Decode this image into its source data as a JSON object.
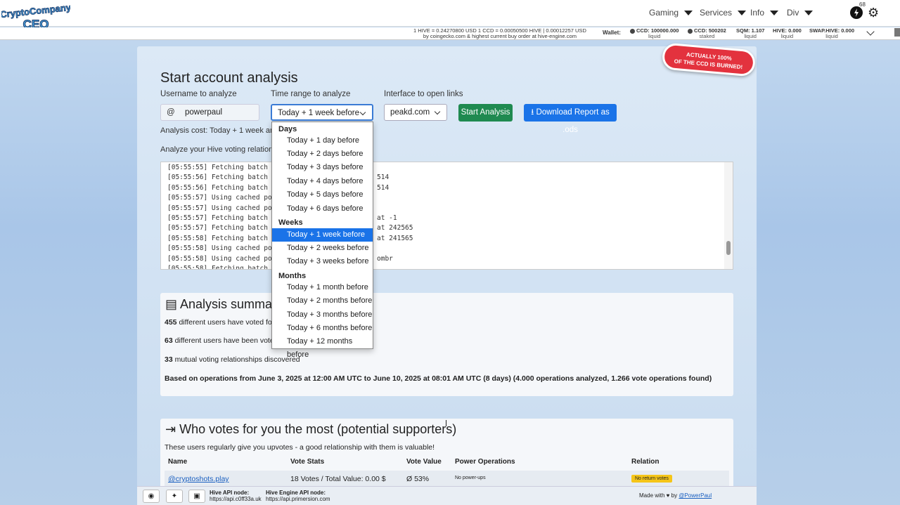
{
  "header": {
    "logo_text_top": "CryptoCompany",
    "logo_text_bottom": "CEO",
    "nav": [
      "Gaming",
      "Services",
      "Info",
      "Div"
    ],
    "notification_count": "68"
  },
  "infobar": {
    "rate_line1": "1 HIVE = 0.24270800 USD      1 CCD = 0.00050500 HIVE | 0.00012257 USD",
    "rate_line2": "by coingecko.com & highest current buy order at hive-engine.com",
    "wallet_label": "Wallet:",
    "wallet": [
      {
        "value": "CCD: 100000.000",
        "sub": "liquid"
      },
      {
        "value": "CCD: 500202",
        "sub": "staked"
      },
      {
        "value": "SQM: 1.107",
        "sub": "liquid"
      },
      {
        "value": "HIVE: 0.000",
        "sub": "liquid"
      },
      {
        "value": "SWAP.HIVE: 0.000",
        "sub": "liquid"
      }
    ]
  },
  "burn_badge": {
    "line1": "ACTUALLY 100%",
    "line2": "OF THE CCD IS BURNED!"
  },
  "form": {
    "title": "Start account analysis",
    "username_label": "Username to analyze",
    "at_sign": "@",
    "username_value": "powerpaul",
    "time_label": "Time range to analyze",
    "time_value": "Today + 1 week before",
    "interface_label": "Interface to open links",
    "interface_value": "peakd.com",
    "start_button": "Start Analysis",
    "download_button": "Download Report as .ods",
    "cost_text": "Analysis cost: Today + 1 week analysis c",
    "analyze_text": "Analyze your Hive voting relationships..."
  },
  "log": [
    {
      "time": "[05:55:55]",
      "msg": "Fetching batch fo",
      "tail": ""
    },
    {
      "time": "[05:55:56]",
      "msg": "Fetching batch fo",
      "tail": "514"
    },
    {
      "time": "[05:55:56]",
      "msg": "Fetching batch fo",
      "tail": "514"
    },
    {
      "time": "[05:55:57]",
      "msg": "Using cached powe",
      "tail": ""
    },
    {
      "time": "[05:55:57]",
      "msg": "Using cached powe",
      "tail": ""
    },
    {
      "time": "[05:55:57]",
      "msg": "Fetching batch fo",
      "tail": "at -1"
    },
    {
      "time": "[05:55:57]",
      "msg": "Fetching batch fo",
      "tail": "at 242565"
    },
    {
      "time": "[05:55:58]",
      "msg": "Fetching batch fo",
      "tail": "at 241565"
    },
    {
      "time": "[05:55:58]",
      "msg": "Using cached powe",
      "tail": ""
    },
    {
      "time": "[05:55:58]",
      "msg": "Using cached powe",
      "tail": "ombr"
    },
    {
      "time": "[05:55:58]",
      "msg": "Fetching batch fo",
      "tail": ""
    }
  ],
  "dropdown": {
    "groups": [
      {
        "label": "Days",
        "options": [
          "Today + 1 day before",
          "Today + 2 days before",
          "Today + 3 days before",
          "Today + 4 days before",
          "Today + 5 days before",
          "Today + 6 days before"
        ]
      },
      {
        "label": "Weeks",
        "options": [
          "Today + 1 week before",
          "Today + 2 weeks before",
          "Today + 3 weeks before"
        ]
      },
      {
        "label": "Months",
        "options": [
          "Today + 1 month before",
          "Today + 2 months before",
          "Today + 3 months before",
          "Today + 6 months before",
          "Today + 12 months before"
        ]
      }
    ],
    "selected": "Today + 1 week before"
  },
  "summary": {
    "title": "Analysis summary f",
    "voted_count": "455",
    "voted_text": " different users have voted for you",
    "voted_by_count": "63",
    "voted_by_text": " different users have been voted by",
    "mutual_count": "33",
    "mutual_text": " mutual voting relationships discovered",
    "based_on": "Based on operations from June 3, 2025 at 12:00 AM UTC to June 10, 2025 at 08:01 AM UTC (8 days) (4.000 operations analyzed, 1.266 vote operations found)"
  },
  "supporters": {
    "title": "Who votes for you the most (potential supporters)",
    "subtitle": "These users regularly give you upvotes - a good relationship with them is valuable!",
    "columns": [
      "Name",
      "Vote Stats",
      "Vote Value",
      "Power Operations",
      "Relation"
    ],
    "rows": [
      {
        "name": "@cryptoshots.play",
        "stats": "18 Votes / Total Value: 0.00 $",
        "value": "Ø 53%",
        "power": "No power-ups",
        "relation": "No return votes"
      }
    ]
  },
  "footer": {
    "hive_api_label": "Hive API node:",
    "hive_api_value": "https://api.c0ff33a.uk",
    "engine_api_label": "Hive Engine API node:",
    "engine_api_value": "https://api.primersion.com",
    "made_with": "Made with ♥ by ",
    "author": "@PowerPaul"
  }
}
